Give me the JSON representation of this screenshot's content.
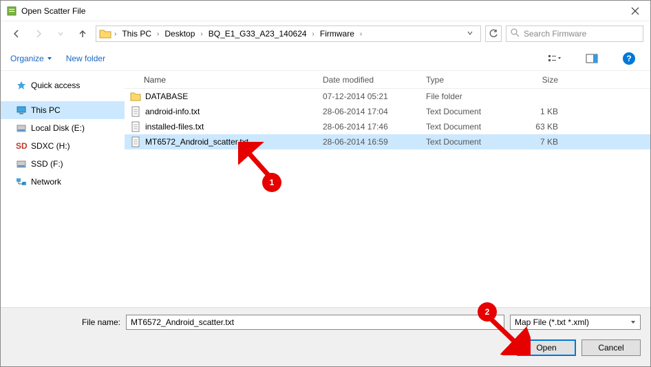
{
  "title": "Open Scatter File",
  "breadcrumb": [
    "This PC",
    "Desktop",
    "BQ_E1_G33_A23_140624",
    "Firmware"
  ],
  "search_placeholder": "Search Firmware",
  "toolbar": {
    "organize": "Organize",
    "new_folder": "New folder"
  },
  "sidebar": {
    "quick": "Quick access",
    "items": [
      {
        "label": "This PC",
        "icon": "pc",
        "selected": true
      },
      {
        "label": "Local Disk (E:)",
        "icon": "disk"
      },
      {
        "label": "SDXC (H:)",
        "icon": "sd"
      },
      {
        "label": "SSD (F:)",
        "icon": "disk"
      },
      {
        "label": "Network",
        "icon": "net"
      }
    ]
  },
  "columns": {
    "name": "Name",
    "date": "Date modified",
    "type": "Type",
    "size": "Size"
  },
  "files": [
    {
      "name": "DATABASE",
      "date": "07-12-2014 05:21",
      "type": "File folder",
      "size": "",
      "icon": "folder",
      "selected": false
    },
    {
      "name": "android-info.txt",
      "date": "28-06-2014 17:04",
      "type": "Text Document",
      "size": "1 KB",
      "icon": "txt",
      "selected": false
    },
    {
      "name": "installed-files.txt",
      "date": "28-06-2014 17:46",
      "type": "Text Document",
      "size": "63 KB",
      "icon": "txt",
      "selected": false
    },
    {
      "name": "MT6572_Android_scatter.txt",
      "date": "28-06-2014 16:59",
      "type": "Text Document",
      "size": "7 KB",
      "icon": "txt",
      "selected": true
    }
  ],
  "footer": {
    "label": "File name:",
    "value": "MT6572_Android_scatter.txt",
    "filter": "Map File (*.txt *.xml)",
    "open": "Open",
    "cancel": "Cancel"
  },
  "callouts": {
    "one": "1",
    "two": "2"
  }
}
